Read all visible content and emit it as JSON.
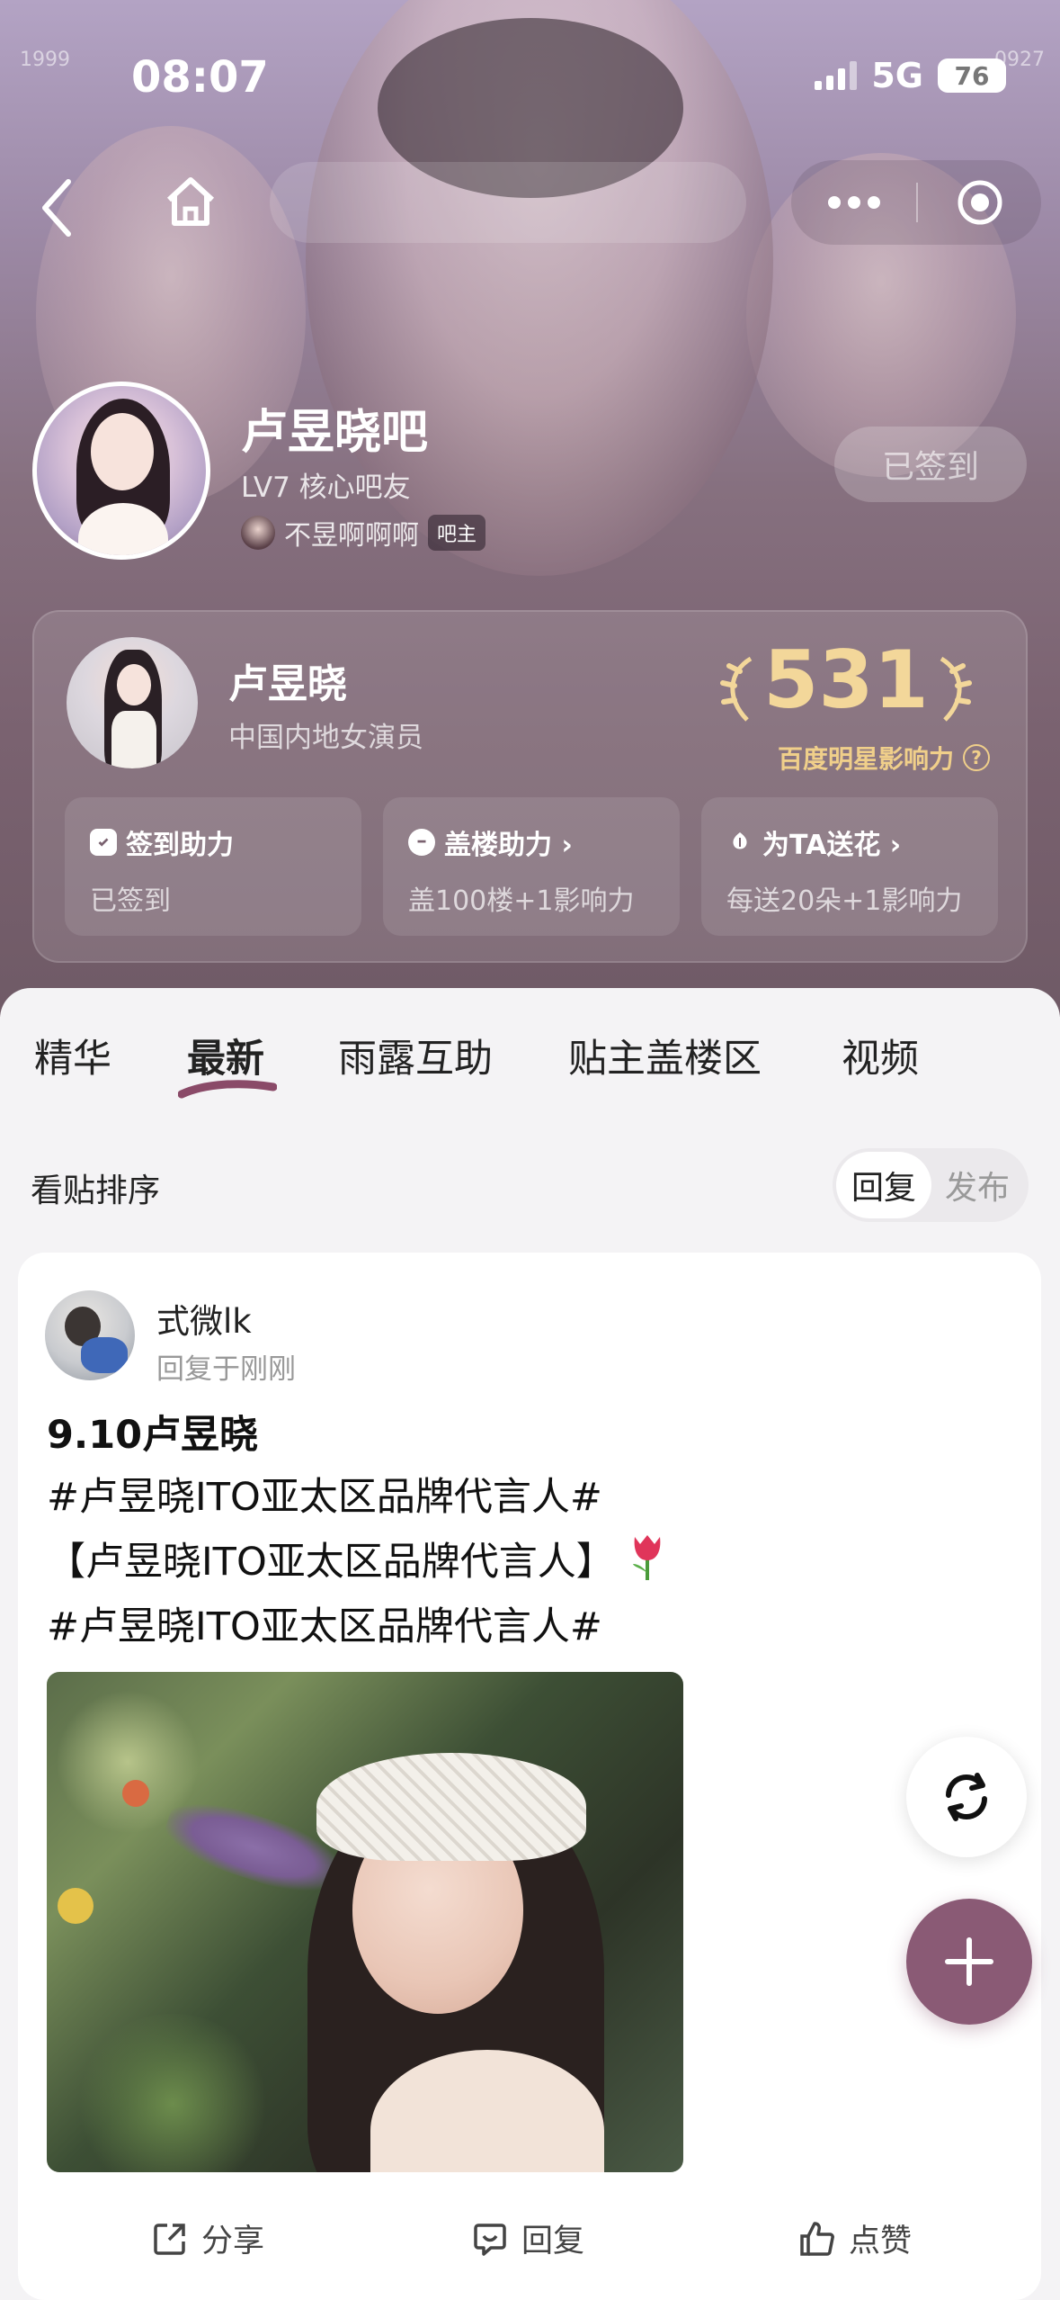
{
  "status_bar": {
    "time": "08:07",
    "network": "5G",
    "battery": "76"
  },
  "header": {
    "deco_left": "1999",
    "deco_right": "0927",
    "forum_name": "卢昱晓吧",
    "user_level": "LV7 核心吧友",
    "admin_name": "不昱啊啊啊",
    "admin_badge": "吧主",
    "sign_button": "已签到"
  },
  "star_card": {
    "name": "卢昱晓",
    "description": "中国内地女演员",
    "score": "531",
    "score_label": "百度明星影响力",
    "boosts": [
      {
        "title": "签到助力",
        "subtitle": "已签到"
      },
      {
        "title": "盖楼助力 ›",
        "subtitle": "盖100楼+1影响力"
      },
      {
        "title": "为TA送花 ›",
        "subtitle": "每送20朵+1影响力"
      }
    ]
  },
  "tabs": [
    "精华",
    "最新",
    "雨露互助",
    "贴主盖楼区",
    "视频"
  ],
  "active_tab": "最新",
  "sort": {
    "label": "看贴排序",
    "options": [
      "回复",
      "发布"
    ],
    "selected": "回复"
  },
  "post": {
    "author": "式微lk",
    "time": "回复于刚刚",
    "title": "9.10卢昱晓",
    "body_lines": [
      "#卢昱晓ITO亚太区品牌代言人#",
      "【卢昱晓ITO亚太区品牌代言人】",
      "#卢昱晓ITO亚太区品牌代言人#"
    ],
    "actions": {
      "share": "分享",
      "reply": "回复",
      "like": "点赞"
    }
  },
  "colors": {
    "accent": "#8a5a75",
    "gold": "#f3d79a",
    "header_bg": "#86707f"
  },
  "icons": [
    "back-icon",
    "home-icon",
    "more-icon",
    "target-icon",
    "help-icon",
    "calendar-icon",
    "chat-icon",
    "flower-icon",
    "share-icon",
    "comment-icon",
    "like-icon",
    "refresh-icon",
    "plus-icon",
    "tulip-icon"
  ]
}
